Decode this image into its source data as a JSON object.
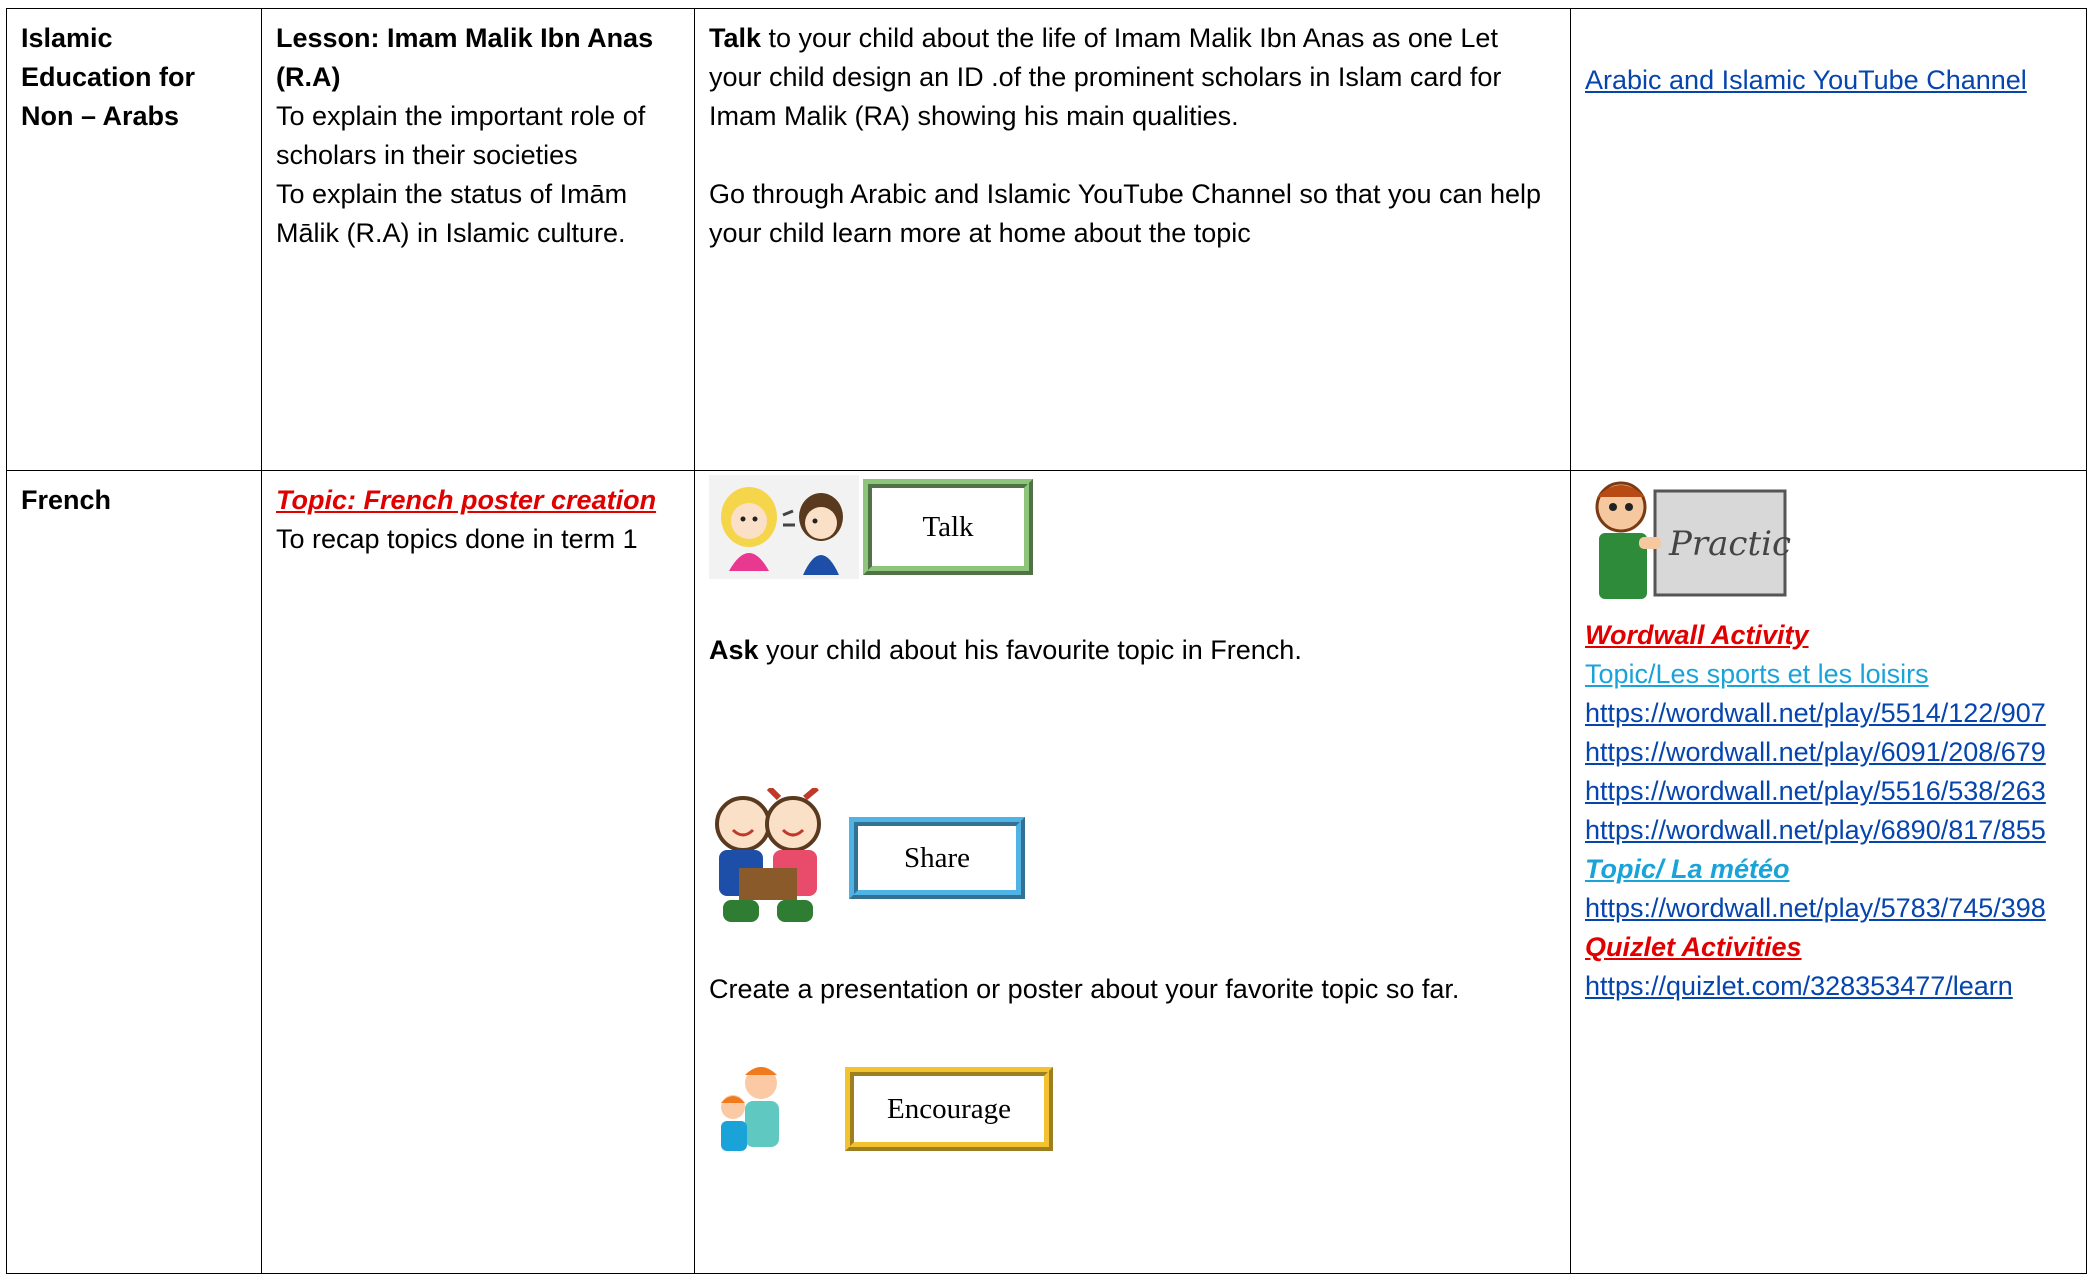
{
  "rows": [
    {
      "subject": "Islamic Education for Non – Arabs",
      "lesson_title": "Lesson: Imam Malik Ibn Anas (R.A)",
      "objectives": [
        "To explain the important role of scholars in their societies",
        "To explain the status of Imām Mālik (R.A) in Islamic culture."
      ],
      "talk_bold": "Talk",
      "talk_text": " to your child about the life of Imam Malik Ibn Anas as one Let your child design an ID  .of the prominent scholars in Islam card for Imam Malik (RA) showing his main qualities.",
      "channel_text": "Go through Arabic and Islamic YouTube Channel so that you can help your child learn more at home about the topic",
      "resource_link": "Arabic and Islamic YouTube Channel"
    },
    {
      "subject": "French",
      "topic": "Topic: French poster creation",
      "objective": "To recap topics done in term 1",
      "talk_button": "Talk",
      "ask_bold": "Ask",
      "ask_text": " your child about his favourite topic in French.",
      "share_button": "Share",
      "create_text": "Create a presentation or poster about your favorite topic so far.",
      "encourage_button": "Encourage",
      "practice_sign": "Practice",
      "wordwall_heading": "Wordwall Activity",
      "topic_sports": " Topic/Les sports et les loisirs",
      "wordwall_links": [
        "https://wordwall.net/play/5514/122/907",
        "https://wordwall.net/play/6091/208/679",
        "https://wordwall.net/play/5516/538/263",
        "https://wordwall.net/play/6890/817/855"
      ],
      "topic_meteo": "Topic/ La météo",
      "meteo_link": "https://wordwall.net/play/5783/745/398",
      "quizlet_heading": "Quizlet Activities",
      "quizlet_link": "https://quizlet.com/328353477/learn"
    }
  ],
  "colors": {
    "link": "#0645ad",
    "heading_red": "#e00000",
    "topic_cyan": "#1aa3d9",
    "talk_frame": "#8dc67a",
    "share_frame": "#4fb3e6",
    "encourage_frame": "#f2c230"
  }
}
